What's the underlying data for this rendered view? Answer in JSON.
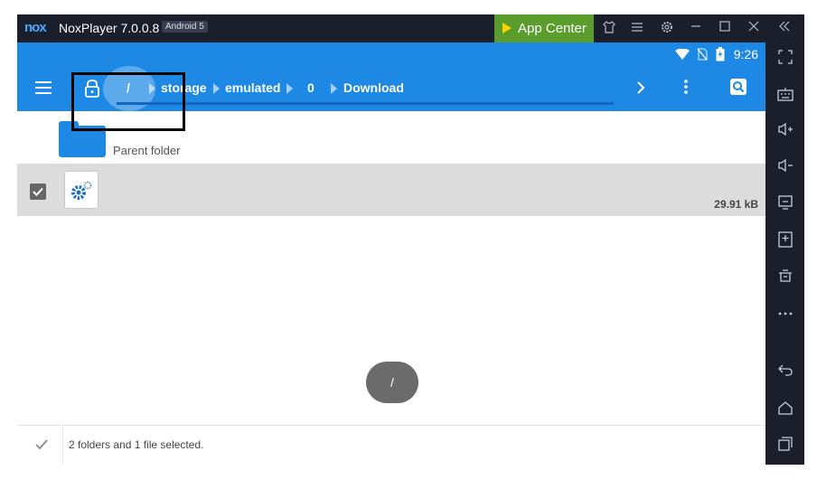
{
  "window": {
    "logo": "nox",
    "title": "NoxPlayer 7.0.0.8",
    "android_badge": "Android 5",
    "app_center_label": "App Center",
    "controls": [
      "shirt-icon",
      "menu-icon",
      "settings-icon",
      "minimize-icon",
      "maximize-icon",
      "close-icon",
      "collapse-icon"
    ]
  },
  "statusbar": {
    "time": "9:26",
    "icons": [
      "wifi-icon",
      "no-sim-icon",
      "battery-icon"
    ]
  },
  "toolbar": {
    "breadcrumb": [
      "/",
      "storage",
      "emulated",
      "0",
      "Download"
    ],
    "icons": [
      "menu-icon",
      "lock-icon",
      "chevron-right-icon",
      "more-vert-icon",
      "search-icon"
    ]
  },
  "list": {
    "parent": {
      "dots": "..",
      "label": "Parent folder"
    },
    "file": {
      "size": "29.91 kB",
      "checked": true
    }
  },
  "toast": {
    "text": "/"
  },
  "footer": {
    "status": "2 folders and 1 file selected."
  },
  "sidebar": {
    "icons": [
      "fullscreen-icon",
      "keyboard-icon",
      "volume-up-icon",
      "volume-down-icon",
      "screen-icon",
      "add-apk-icon",
      "clean-icon",
      "more-icon",
      "back-icon",
      "home-icon",
      "recents-icon"
    ]
  },
  "colors": {
    "accent": "#1e88e5",
    "frame": "#1b1e2b",
    "app_center": "#5b9d2d"
  }
}
